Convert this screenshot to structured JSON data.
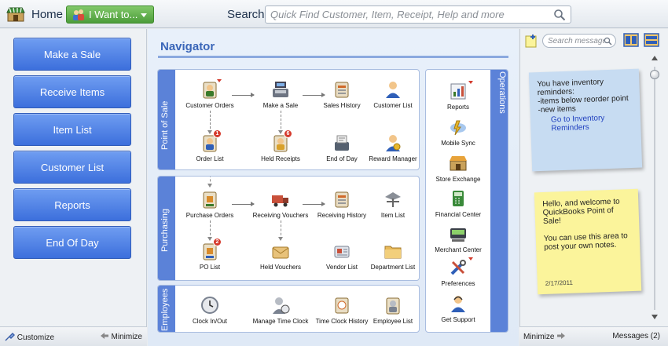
{
  "topbar": {
    "home_label": "Home",
    "iwant_label": "I Want to...",
    "search_label": "Search",
    "search_placeholder": "Quick Find Customer, Item, Receipt, Help and more"
  },
  "left_buttons": [
    "Make a Sale",
    "Receive Items",
    "Item List",
    "Customer List",
    "Reports",
    "End Of Day"
  ],
  "left_footer": {
    "customize": "Customize",
    "minimize": "Minimize"
  },
  "navigator": {
    "title": "Navigator",
    "sections": {
      "point_of_sale": "Point of Sale",
      "purchasing": "Purchasing",
      "employees": "Employees",
      "operations": "Operations"
    },
    "pos_items": [
      "Customer Orders",
      "Make a Sale",
      "Sales History",
      "Customer List",
      "Order List",
      "Held Receipts",
      "End of Day",
      "Reward Manager"
    ],
    "pos_badges": {
      "order_list": "1",
      "held_receipts": "6"
    },
    "purchasing_items": [
      "Purchase Orders",
      "Receiving Vouchers",
      "Receiving History",
      "Item List",
      "PO List",
      "Held Vouchers",
      "Vendor List",
      "Department List"
    ],
    "purchasing_badges": {
      "po_list": "2"
    },
    "employee_items": [
      "Clock In/Out",
      "Manage Time Clock",
      "Time Clock History",
      "Employee List"
    ],
    "operations_items": [
      "Reports",
      "Mobile Sync",
      "Store Exchange",
      "Financial Center",
      "Merchant Center",
      "Preferences",
      "Get Support"
    ]
  },
  "right_panel": {
    "search_placeholder": "Search messages",
    "note1": {
      "line1": "You have inventory",
      "line2": "reminders:",
      "line3": "-items below reorder point",
      "line4": "-new items",
      "link": "Go to Inventory Reminders"
    },
    "note2": {
      "text1": "Hello, and welcome to QuickBooks Point of Sale!",
      "text2": "You can use this area to post your own notes.",
      "date": "2/17/2011"
    }
  },
  "right_footer": {
    "minimize": "Minimize",
    "messages": "Messages (2)"
  },
  "colors": {
    "button_blue": "#4f82e6",
    "nav_title": "#3a66b8",
    "iwant_green": "#5bab47",
    "note_blue": "#c7dcf2",
    "note_yellow": "#fbf49b"
  }
}
